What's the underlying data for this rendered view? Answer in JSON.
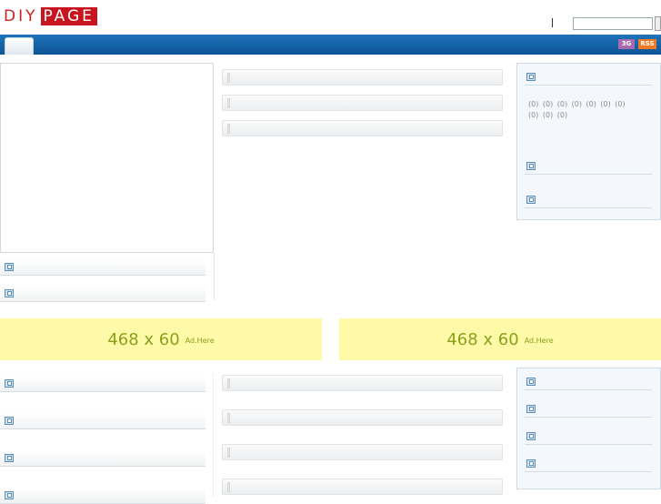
{
  "header": {
    "logo_part1": "DIY",
    "logo_part2": "PAGE",
    "search_placeholder": ""
  },
  "nav": {
    "tabs": [
      ""
    ],
    "badge_3g": "3G",
    "badge_rss": "RSS"
  },
  "sidebar_right": {
    "counts_line1": "(0)  (0)  (0)  (0)  (0)  (0)  (0)",
    "counts_line2": "(0)  (0)  (0)"
  },
  "ads": [
    {
      "size": "468 x 60",
      "label": "Ad.Here"
    },
    {
      "size": "468 x 60",
      "label": "Ad.Here"
    }
  ],
  "colors": {
    "nav_blue": "#1366ad",
    "logo_red": "#c8141e",
    "ad_yellow": "#fffaa8",
    "ad_text": "#8aa01e"
  }
}
